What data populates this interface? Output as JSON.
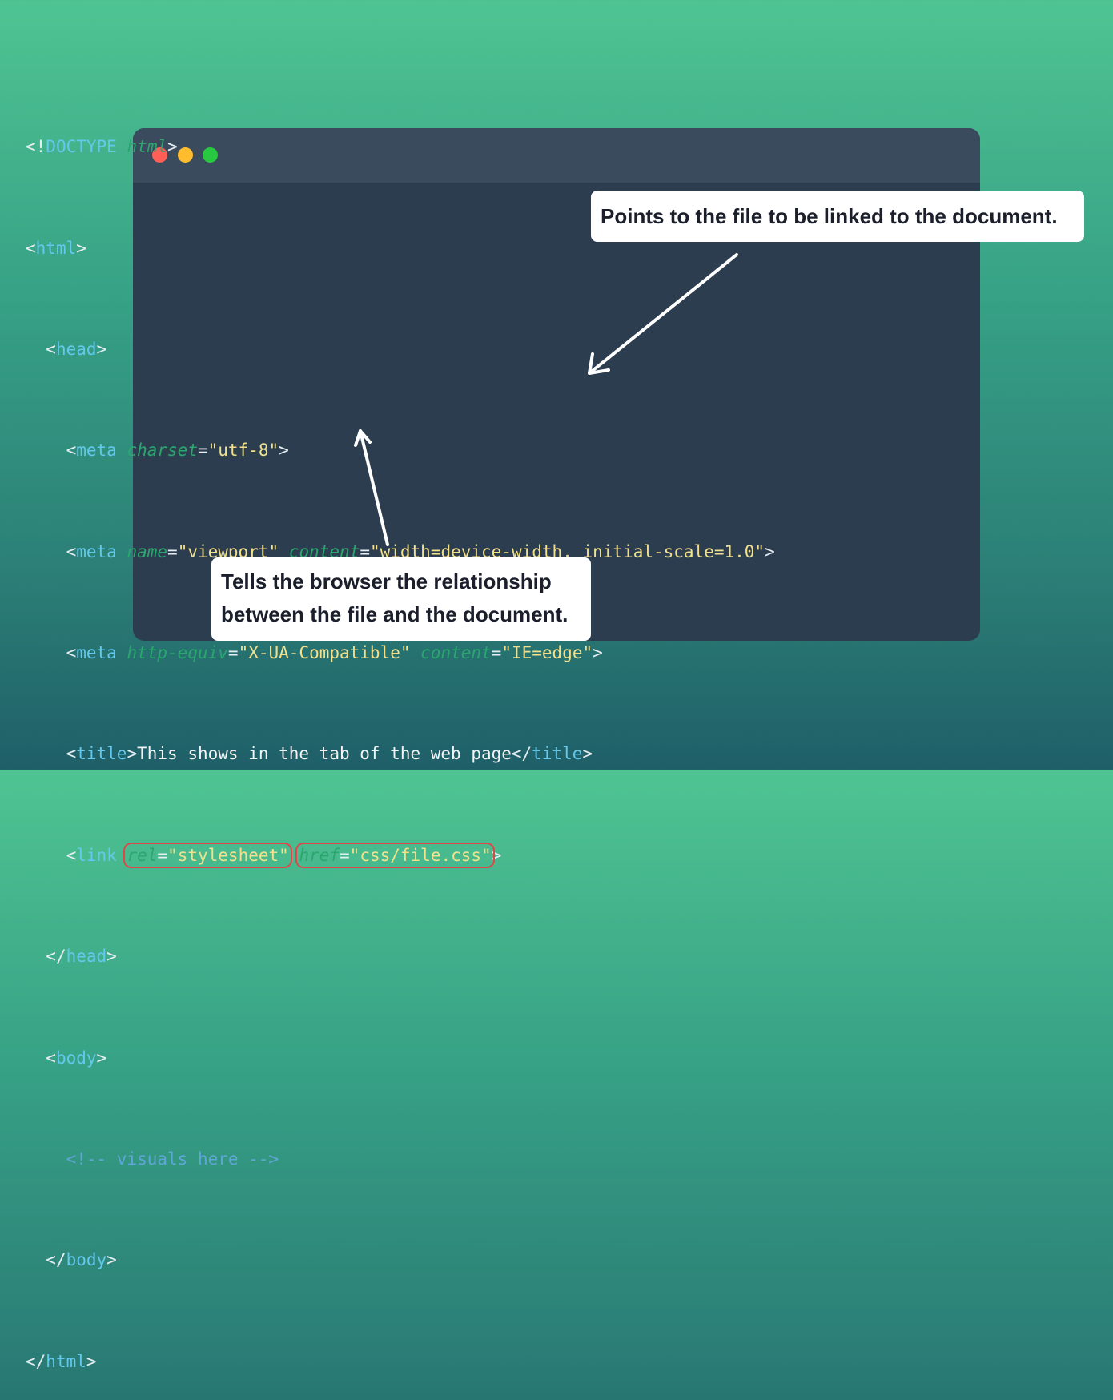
{
  "window": {
    "controls": [
      "close",
      "minimize",
      "maximize"
    ],
    "colors": {
      "close": "#ff5f57",
      "minimize": "#febc2e",
      "maximize": "#28c840",
      "highlight": "#e0474c"
    }
  },
  "code": {
    "l1": {
      "p1": "<!",
      "t1": "DOCTYPE",
      "sp": " ",
      "a1": "html",
      "p2": ">"
    },
    "l2": {
      "p1": "<",
      "t1": "html",
      "p2": ">"
    },
    "l3": {
      "ind": "  ",
      "p1": "<",
      "t1": "head",
      "p2": ">"
    },
    "l4": {
      "ind": "    ",
      "p1": "<",
      "t1": "meta",
      "sp": " ",
      "a1": "charset",
      "eq": "=",
      "s1": "\"utf-8\"",
      "p2": ">"
    },
    "l5": {
      "ind": "    ",
      "p1": "<",
      "t1": "meta",
      "sp": " ",
      "a1": "name",
      "eq1": "=",
      "s1": "\"viewport\"",
      "sp2": " ",
      "a2": "content",
      "eq2": "=",
      "s2": "\"width=device-width, initial-scale=1.0\"",
      "p2": ">"
    },
    "l6": {
      "ind": "    ",
      "p1": "<",
      "t1": "meta",
      "sp": " ",
      "a1": "http-equiv",
      "eq1": "=",
      "s1": "\"X-UA-Compatible\"",
      "sp2": " ",
      "a2": "content",
      "eq2": "=",
      "s2": "\"IE=edge\"",
      "p2": ">"
    },
    "l7": {
      "ind": "    ",
      "p1": "<",
      "t1": "title",
      "p2": ">",
      "x": "This shows in the tab of the web page",
      "p3": "</",
      "t2": "title",
      "p4": ">"
    },
    "l8": {
      "ind": "    ",
      "p1": "<",
      "t1": "link",
      "sp": " ",
      "a1": "rel",
      "eq1": "=",
      "s1": "\"stylesheet\"",
      "sp2": " ",
      "a2": "href",
      "eq2": "=",
      "s2": "\"css/file.css\"",
      "p2": ">"
    },
    "l9": {
      "ind": "  ",
      "p1": "</",
      "t1": "head",
      "p2": ">"
    },
    "l10": {
      "ind": "  ",
      "p1": "<",
      "t1": "body",
      "p2": ">"
    },
    "l11": {
      "ind": "    ",
      "c": "<!-- visuals here -->"
    },
    "l12": {
      "ind": "  ",
      "p1": "</",
      "t1": "body",
      "p2": ">"
    },
    "l13": {
      "p1": "</",
      "t1": "html",
      "p2": ">"
    }
  },
  "callouts": {
    "href_note": "Points to the file to be linked to the document.",
    "rel_note_line1": "Tells the browser the relationship",
    "rel_note_line2": "between the file and the document."
  }
}
